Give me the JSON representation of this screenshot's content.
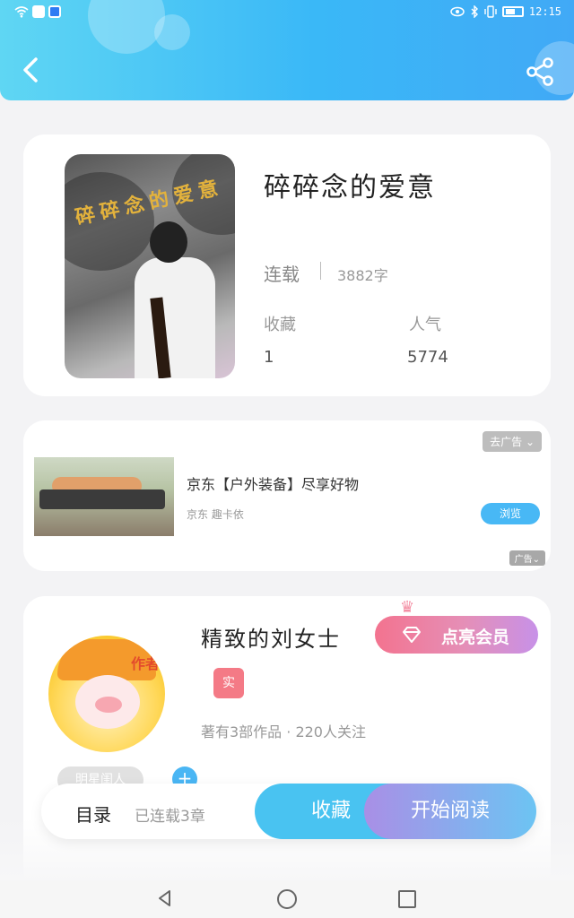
{
  "status_bar": {
    "time": "12:15"
  },
  "book": {
    "cover_title": "碎碎念的爱意",
    "title": "碎碎念的爱意",
    "status": "连载",
    "word_count": "3882字",
    "favorites_label": "收藏",
    "favorites_value": "1",
    "popularity_label": "人气",
    "popularity_value": "5774"
  },
  "ad": {
    "tag": "去广告 ⌄",
    "title": "京东【户外装备】尽享好物",
    "source": "京东 趣卡依",
    "browse_label": "浏览",
    "mark": "广告⌄"
  },
  "author": {
    "avatar_label": "作者",
    "name": "精致的刘女士",
    "vip_label": "点亮会员",
    "badge": "实",
    "works": "著有3部作品 · 220人关注",
    "star_tag": "明星闺人",
    "follow_symbol": "+"
  },
  "actions": {
    "toc_label": "目录",
    "chapters": "已连载3章",
    "collect_label": "收藏",
    "read_label": "开始阅读"
  },
  "colors": {
    "header_start": "#5fd6f3",
    "header_end": "#41a9f6",
    "accent_blue": "#49c3f1",
    "vip_pink": "#f3738f",
    "read_purple": "#a98fe6"
  }
}
